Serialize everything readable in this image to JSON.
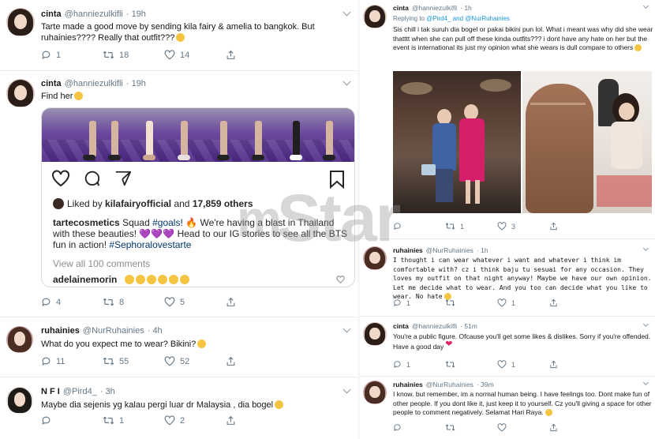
{
  "left": {
    "tweets": [
      {
        "name": "cinta",
        "handle": "@hanniezulkifli",
        "time": "· 19h",
        "text": "Tarte made a good move by sending kila fairy & amelia to bangkok. But ruhainies???? Really that outfit???",
        "replies": "1",
        "retweets": "18",
        "likes": "14"
      },
      {
        "name": "cinta",
        "handle": "@hanniezulkifli",
        "time": "· 19h",
        "text": "Find her",
        "replies": "4",
        "retweets": "8",
        "likes": "5",
        "instagram": {
          "liked_by_prefix": "Liked by",
          "liked_by_user": "kilafairyofficial",
          "liked_by_and": "and",
          "liked_by_count": "17,859 others",
          "caption_user": "tartecosmetics",
          "caption_pre": "Squad",
          "caption_tag1": "#goals!",
          "caption_mid": "We're having a blast in Thailand with these beauties!",
          "caption_post": "Head to our IG stories to see all the BTS fun in action!",
          "caption_tag2": "#Sephoralovestarte",
          "view_all": "View all 100 comments",
          "comment_user": "adelainemorin"
        }
      },
      {
        "name": "ruhainies",
        "handle": "@NurRuhainies",
        "time": "· 4h",
        "text": "What do you expect me to wear? Bikini?",
        "replies": "11",
        "retweets": "55",
        "likes": "52"
      },
      {
        "name": "N F I",
        "handle": "@Pird4_",
        "time": "· 3h",
        "text": "Maybe dia sejenis yg kalau pergi luar dr Malaysia , dia bogel",
        "replies": "",
        "retweets": "1",
        "likes": "2"
      }
    ]
  },
  "right": {
    "tweets": [
      {
        "name": "cinta",
        "handle": "@hanniezulkifli",
        "time": "· 1h",
        "replying_prefix": "Replying to",
        "replying_to": "@Pird4_ and @NurRuhainies",
        "text": "Sis chill i tak suruh dia bogel or pakai bikini pun lol. What i meant was why did she wear thatttt when she can pull off these kinda outfits??? i dont have any hate on her but the event is international its just my opinion what she wears is dull compare to others",
        "replies": "",
        "retweets": "1",
        "likes": "3"
      },
      {
        "name": "ruhainies",
        "handle": "@NurRuhainies",
        "time": "· 1h",
        "text": "I thought i can wear whatever i want and whatever i think im comfortable with? cz i think baju tu sesuai for any occasion. They loves my outfit on that night anyway! Maybe we have our own opinion. Let me decide what to wear. And you too can decide what you like to wear. No hate",
        "replies": "1",
        "retweets": "",
        "likes": "1"
      },
      {
        "name": "cinta",
        "handle": "@hanniezulkifli",
        "time": "· 51m",
        "text": "You're a public figure. Ofcause you'll get some likes & dislikes. Sorry if you're offended. Have a good day",
        "replies": "1",
        "retweets": "",
        "likes": "1"
      },
      {
        "name": "ruhainies",
        "handle": "@NurRuhainies",
        "time": "· 39m",
        "text": "I know. but remember, im a normal human being. I have feelings too. Dont make fun of other people. If you dont like it, just keep it to yourself. Cz you'll giving a space for other people to comment negatively. Selamat Hari Raya.",
        "replies": "",
        "retweets": "",
        "likes": ""
      }
    ]
  },
  "watermark": {
    "brand_m": "m",
    "brand": "Star"
  },
  "colors": {
    "link": "#1b95e0",
    "muted": "#657786",
    "like_red": "#e0245e",
    "ig_tag": "#00376b"
  }
}
